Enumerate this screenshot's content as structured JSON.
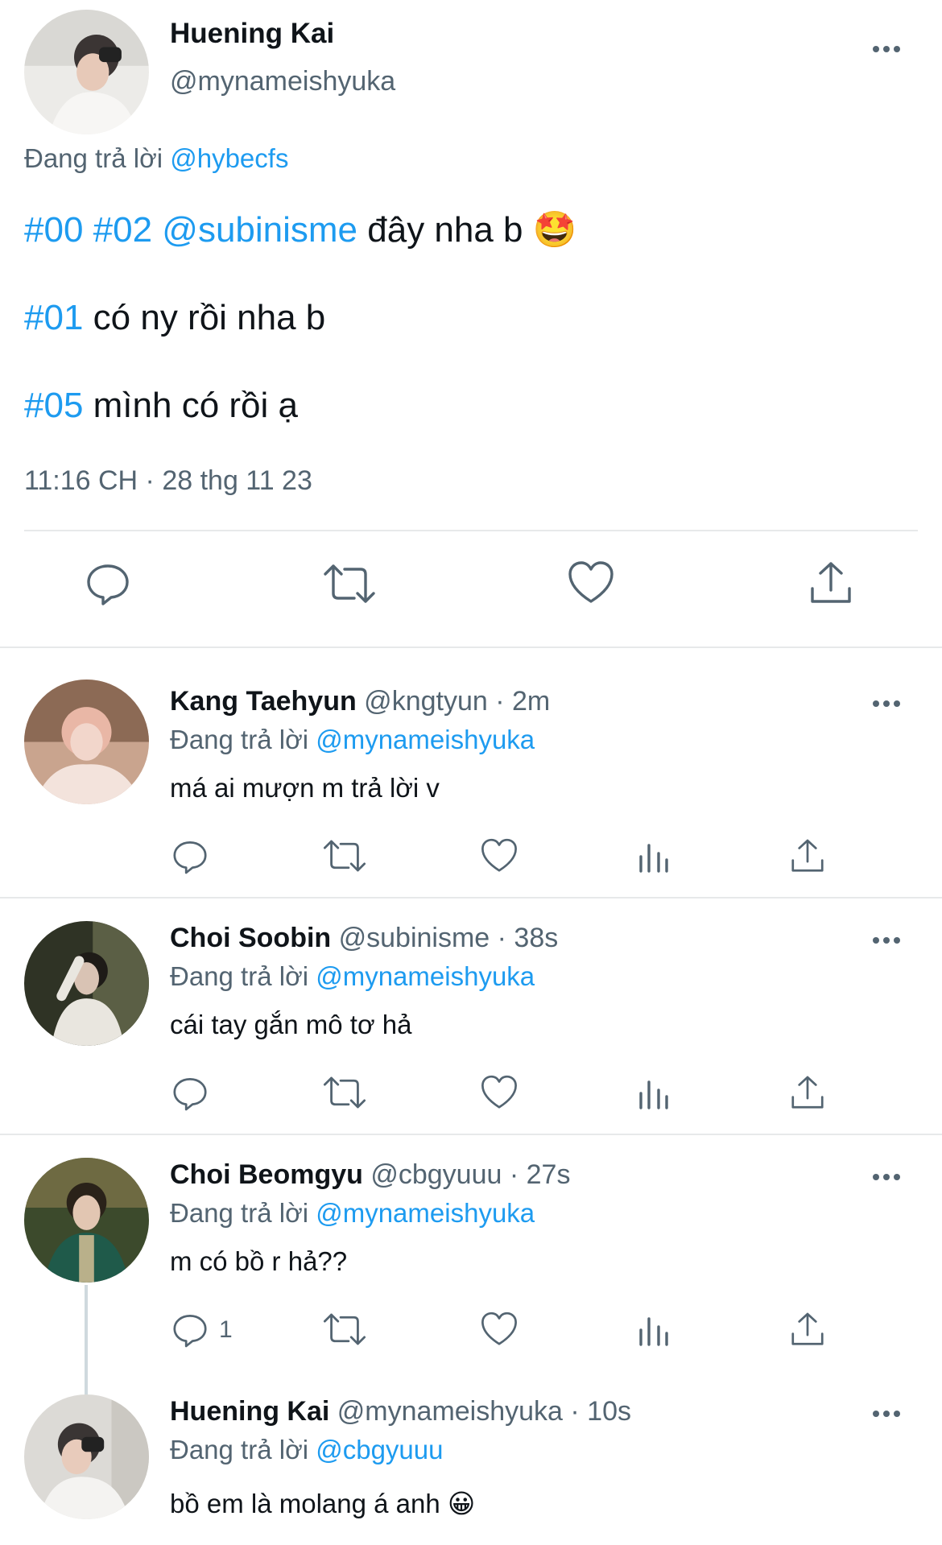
{
  "main_tweet": {
    "name": "Huening Kai",
    "handle": "@mynameishyuka",
    "replying_prefix": "Đang trả lời",
    "replying_to": "@hybecfs",
    "lines": [
      {
        "tags": "#00 #02 @subinisme",
        "text": " đây nha b ",
        "emoji": "🤩"
      },
      {
        "tags": "#01",
        "text": " có ny rồi nha b",
        "emoji": ""
      },
      {
        "tags": "#05",
        "text": " mình có rồi ạ",
        "emoji": ""
      }
    ],
    "timestamp": "11:16 CH · 28 thg 11 23",
    "actions": [
      "reply-icon",
      "retweet-icon",
      "like-icon",
      "share-icon"
    ]
  },
  "replies": [
    {
      "name": "Kang Taehyun",
      "meta": " @kngtyun · 2m",
      "replying_prefix": "Đang trả lời",
      "replying_to": "@mynameishyuka",
      "text": "má ai mượn m trả lời v",
      "reply_count": "",
      "avatar_colors": [
        "#e9cfc6",
        "#c9a48e",
        "#f3e3dc"
      ]
    },
    {
      "name": "Choi Soobin",
      "meta": " @subinisme · 38s",
      "replying_prefix": "Đang trả lời",
      "replying_to": "@mynameishyuka",
      "text": "cái tay gắn mô tơ hả",
      "reply_count": "",
      "avatar_colors": [
        "#2f3325",
        "#8a8f6a",
        "#e9e6df"
      ]
    },
    {
      "name": "Choi Beomgyu",
      "meta": " @cbgyuuu · 27s",
      "replying_prefix": "Đang trả lời",
      "replying_to": "@mynameishyuka",
      "text": "m có bồ r hả??",
      "reply_count": "1",
      "avatar_colors": [
        "#3c4a2c",
        "#1f5a4a",
        "#b9b08a"
      ]
    },
    {
      "name": "Huening Kai",
      "meta": " @mynameishyuka · 10s",
      "replying_prefix": "Đang trả lời",
      "replying_to": "@cbgyuuu",
      "text": "bồ em là molang á anh ",
      "emoji": "😀",
      "reply_count": "",
      "avatar_colors": [
        "#dcdad6",
        "#3a3534",
        "#f4f3f1"
      ]
    }
  ],
  "colors": {
    "link": "#1d9bf0",
    "muted": "#536471",
    "divider": "#e7e9ea"
  }
}
